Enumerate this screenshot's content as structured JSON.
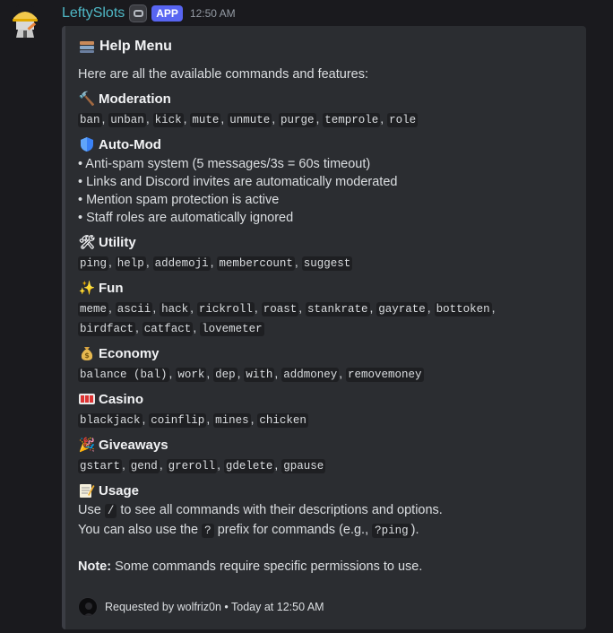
{
  "message": {
    "author": "LeftySlots",
    "badge": "APP",
    "timestamp": "12:50 AM"
  },
  "embed": {
    "title": "Help Menu",
    "title_icon": "card-file-box-icon",
    "description": "Here are all the available commands and features:",
    "sections": {
      "moderation": {
        "title": "Moderation",
        "icon": "hammer-icon",
        "commands": [
          "ban",
          "unban",
          "kick",
          "mute",
          "unmute",
          "purge",
          "temprole",
          "role"
        ]
      },
      "automod": {
        "title": "Auto-Mod",
        "icon": "shield-icon",
        "bullets": [
          "• Anti-spam system (5 messages/3s = 60s timeout)",
          "• Links and Discord invites are automatically moderated",
          "• Mention spam protection is active",
          "• Staff roles are automatically ignored"
        ]
      },
      "utility": {
        "title": "Utility",
        "icon": "hammer-and-wrench-icon",
        "commands": [
          "ping",
          "help",
          "addemoji",
          "membercount",
          "suggest"
        ]
      },
      "fun": {
        "title": "Fun",
        "icon": "sparkles-icon",
        "commands": [
          "meme",
          "ascii",
          "hack",
          "rickroll",
          "roast",
          "stankrate",
          "gayrate",
          "bottoken",
          "birdfact",
          "catfact",
          "lovemeter"
        ]
      },
      "economy": {
        "title": "Economy",
        "icon": "money-bag-icon",
        "commands": [
          "balance (bal)",
          "work",
          "dep",
          "with",
          "addmoney",
          "removemoney"
        ]
      },
      "casino": {
        "title": "Casino",
        "icon": "slot-machine-icon",
        "commands": [
          "blackjack",
          "coinflip",
          "mines",
          "chicken"
        ]
      },
      "giveaways": {
        "title": "Giveaways",
        "icon": "party-popper-icon",
        "commands": [
          "gstart",
          "gend",
          "greroll",
          "gdelete",
          "gpause"
        ]
      },
      "usage": {
        "title": "Usage",
        "icon": "memo-icon",
        "line1_pre": "Use",
        "line1_code": "/",
        "line1_post": "to see all commands with their descriptions and options.",
        "line2_pre": "You can also use the",
        "line2_code": "?",
        "line2_mid": "prefix for commands (e.g.,",
        "line2_code2": "?ping",
        "line2_post": ")."
      }
    },
    "note_label": "Note:",
    "note_text": "Some commands require specific permissions to use.",
    "footer": "Requested by wolfriz0n • Today at 12:50 AM"
  },
  "colors": {
    "background": "#1a1a1e",
    "embed": "#2b2d31",
    "username": "#4fb8c6",
    "app_badge": "#5865f2"
  }
}
